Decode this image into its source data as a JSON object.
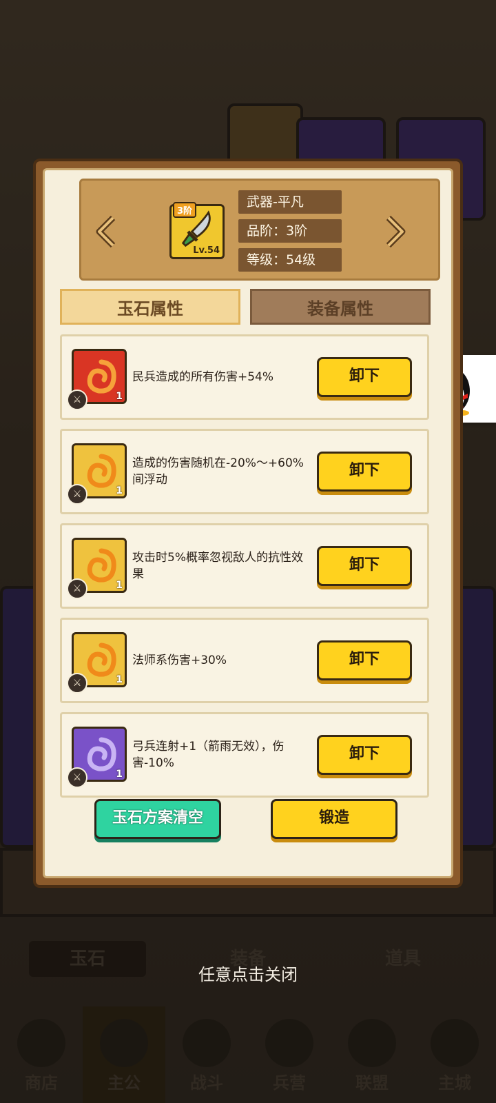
{
  "dialog": {
    "item": {
      "tier_badge": "3阶",
      "level_badge": "Lv.54",
      "name": "武器-平凡",
      "quality": "品阶：3阶",
      "level": "等级：54级"
    },
    "tabs": [
      {
        "label": "玉石属性",
        "active": true
      },
      {
        "label": "装备属性",
        "active": false
      }
    ],
    "jades": [
      {
        "color": "red",
        "count": "1",
        "desc": "民兵造成的所有伤害+54%",
        "button": "卸下"
      },
      {
        "color": "gold",
        "count": "1",
        "desc": "造成的伤害随机在-20%～+60%间浮动",
        "button": "卸下"
      },
      {
        "color": "gold",
        "count": "1",
        "desc": "攻击时5%概率忽视敌人的抗性效果",
        "button": "卸下"
      },
      {
        "color": "gold",
        "count": "1",
        "desc": "法师系伤害+30%",
        "button": "卸下"
      },
      {
        "color": "purple",
        "count": "1",
        "desc": "弓兵连射+1（箭雨无效），伤害-10%",
        "button": "卸下"
      }
    ],
    "clear_button": "玉石方案清空",
    "forge_button": "锻造"
  },
  "close_hint": "任意点击关闭",
  "background": {
    "tabs": [
      "玉石",
      "装备",
      "道具"
    ],
    "nav": [
      "商店",
      "主公",
      "战斗",
      "兵营",
      "联盟",
      "主城"
    ]
  },
  "colors": {
    "button_yellow": "#ffd21e",
    "button_green": "#2fd3a0",
    "panel": "#f6efdc",
    "jade_red": "#d93524",
    "jade_gold": "#efc23e",
    "jade_purple": "#7a52c8"
  },
  "icons": {
    "item": "sword-icon",
    "prev": "chevron-left-icon",
    "next": "chevron-right-icon",
    "jade_type": "sword-small-icon",
    "floating": "qq-penguin-icon"
  }
}
